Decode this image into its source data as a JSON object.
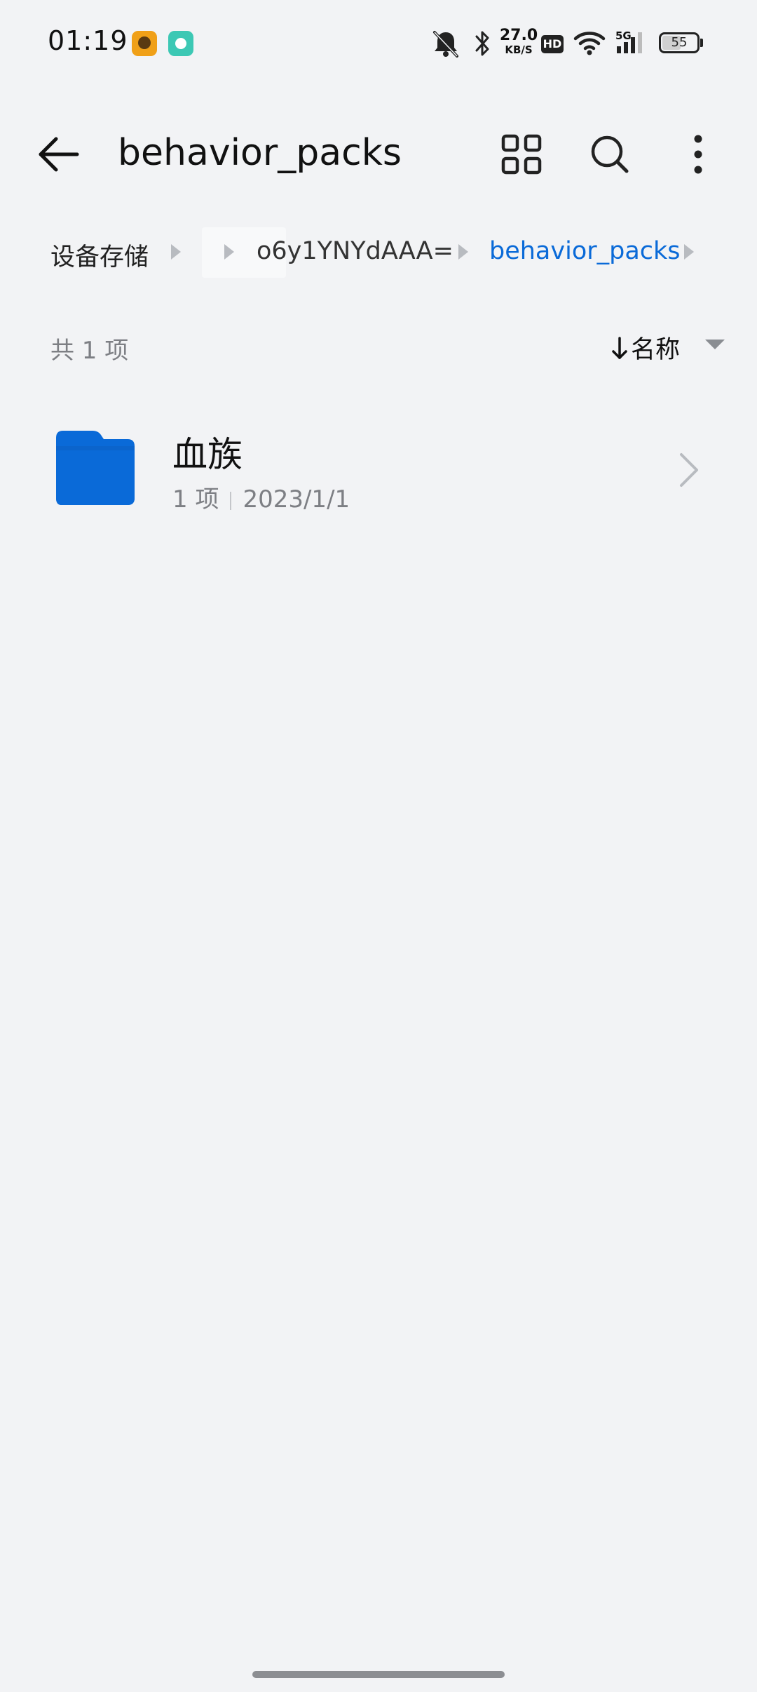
{
  "status_bar": {
    "time": "01:19",
    "net_speed_value": "27.0",
    "net_speed_unit": "KB/S",
    "hd_label": "HD",
    "network_label": "5G",
    "battery_level": "55",
    "icons": [
      "app-notification-icon",
      "app-notification-icon",
      "mute-bell-icon",
      "bluetooth-icon",
      "wifi-icon",
      "cell-signal-icon",
      "battery-icon"
    ]
  },
  "toolbar": {
    "title": "behavior_packs",
    "back_icon": "arrow-left-icon",
    "grid_icon": "grid-view-icon",
    "search_icon": "search-icon",
    "more_icon": "more-vertical-icon"
  },
  "breadcrumb": {
    "items": [
      {
        "label": "设备存储"
      },
      {
        "label": ""
      },
      {
        "label": "o6y1YNYdAAA="
      },
      {
        "label": "behavior_packs"
      }
    ],
    "active_color": "#0a6ad8"
  },
  "list": {
    "count_label": "共 1 项",
    "sort_label": "名称",
    "items": [
      {
        "name": "血族",
        "count": "1 项",
        "date": "2023/1/1"
      }
    ]
  },
  "colors": {
    "background": "#f2f3f5",
    "folder": "#0a6ad8",
    "accent": "#0a6ad8"
  }
}
